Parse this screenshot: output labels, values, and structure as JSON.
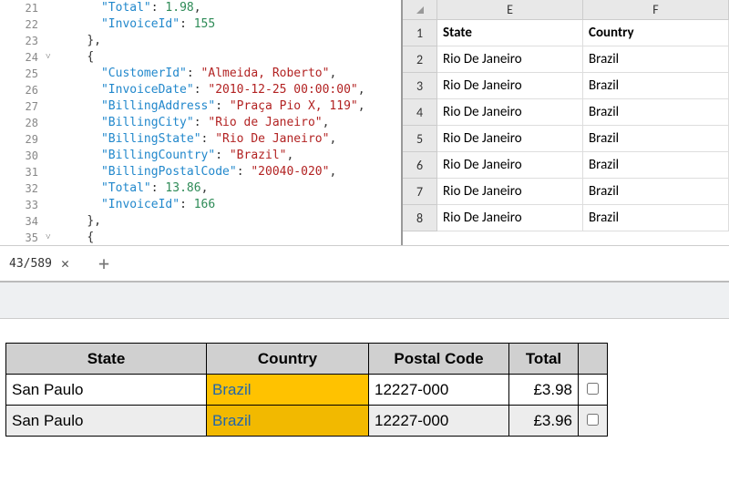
{
  "code": {
    "lines": [
      {
        "ln": 21,
        "fold": "",
        "indent": 6,
        "tokens": [
          {
            "t": "k",
            "v": "\"Total\""
          },
          {
            "t": "p",
            "v": ": "
          },
          {
            "t": "n",
            "v": "1.98"
          },
          {
            "t": "p",
            "v": ","
          }
        ]
      },
      {
        "ln": 22,
        "fold": "",
        "indent": 6,
        "tokens": [
          {
            "t": "k",
            "v": "\"InvoiceId\""
          },
          {
            "t": "p",
            "v": ": "
          },
          {
            "t": "n",
            "v": "155"
          }
        ]
      },
      {
        "ln": 23,
        "fold": "",
        "indent": 4,
        "tokens": [
          {
            "t": "p",
            "v": "},"
          }
        ]
      },
      {
        "ln": 24,
        "fold": "˅",
        "indent": 4,
        "tokens": [
          {
            "t": "p",
            "v": "{"
          }
        ]
      },
      {
        "ln": 25,
        "fold": "",
        "indent": 6,
        "tokens": [
          {
            "t": "k",
            "v": "\"CustomerId\""
          },
          {
            "t": "p",
            "v": ": "
          },
          {
            "t": "s",
            "v": "\"Almeida, Roberto\""
          },
          {
            "t": "p",
            "v": ","
          }
        ]
      },
      {
        "ln": 26,
        "fold": "",
        "indent": 6,
        "tokens": [
          {
            "t": "k",
            "v": "\"InvoiceDate\""
          },
          {
            "t": "p",
            "v": ": "
          },
          {
            "t": "s",
            "v": "\"2010-12-25 00:00:00\""
          },
          {
            "t": "p",
            "v": ","
          }
        ]
      },
      {
        "ln": 27,
        "fold": "",
        "indent": 6,
        "tokens": [
          {
            "t": "k",
            "v": "\"BillingAddress\""
          },
          {
            "t": "p",
            "v": ": "
          },
          {
            "t": "s",
            "v": "\"Praça Pio X, 119\""
          },
          {
            "t": "p",
            "v": ","
          }
        ]
      },
      {
        "ln": 28,
        "fold": "",
        "indent": 6,
        "tokens": [
          {
            "t": "k",
            "v": "\"BillingCity\""
          },
          {
            "t": "p",
            "v": ": "
          },
          {
            "t": "s",
            "v": "\"Rio de Janeiro\""
          },
          {
            "t": "p",
            "v": ","
          }
        ]
      },
      {
        "ln": 29,
        "fold": "",
        "indent": 6,
        "tokens": [
          {
            "t": "k",
            "v": "\"BillingState\""
          },
          {
            "t": "p",
            "v": ": "
          },
          {
            "t": "s",
            "v": "\"Rio De Janeiro\""
          },
          {
            "t": "p",
            "v": ","
          }
        ]
      },
      {
        "ln": 30,
        "fold": "",
        "indent": 6,
        "tokens": [
          {
            "t": "k",
            "v": "\"BillingCountry\""
          },
          {
            "t": "p",
            "v": ": "
          },
          {
            "t": "s",
            "v": "\"Brazil\""
          },
          {
            "t": "p",
            "v": ","
          }
        ]
      },
      {
        "ln": 31,
        "fold": "",
        "indent": 6,
        "tokens": [
          {
            "t": "k",
            "v": "\"BillingPostalCode\""
          },
          {
            "t": "p",
            "v": ": "
          },
          {
            "t": "s",
            "v": "\"20040-020\""
          },
          {
            "t": "p",
            "v": ","
          }
        ]
      },
      {
        "ln": 32,
        "fold": "",
        "indent": 6,
        "tokens": [
          {
            "t": "k",
            "v": "\"Total\""
          },
          {
            "t": "p",
            "v": ": "
          },
          {
            "t": "n",
            "v": "13.86"
          },
          {
            "t": "p",
            "v": ","
          }
        ]
      },
      {
        "ln": 33,
        "fold": "",
        "indent": 6,
        "tokens": [
          {
            "t": "k",
            "v": "\"InvoiceId\""
          },
          {
            "t": "p",
            "v": ": "
          },
          {
            "t": "n",
            "v": "166"
          }
        ]
      },
      {
        "ln": 34,
        "fold": "",
        "indent": 4,
        "tokens": [
          {
            "t": "p",
            "v": "},"
          }
        ]
      },
      {
        "ln": 35,
        "fold": "˅",
        "indent": 4,
        "tokens": [
          {
            "t": "p",
            "v": "{"
          }
        ]
      }
    ]
  },
  "sheet": {
    "cols": [
      "E",
      "F"
    ],
    "rows": [
      {
        "n": 1,
        "cells": [
          "State",
          "Country"
        ],
        "header": true
      },
      {
        "n": 2,
        "cells": [
          "Rio De Janeiro",
          "Brazil"
        ]
      },
      {
        "n": 3,
        "cells": [
          "Rio De Janeiro",
          "Brazil"
        ]
      },
      {
        "n": 4,
        "cells": [
          "Rio De Janeiro",
          "Brazil"
        ]
      },
      {
        "n": 5,
        "cells": [
          "Rio De Janeiro",
          "Brazil"
        ]
      },
      {
        "n": 6,
        "cells": [
          "Rio De Janeiro",
          "Brazil"
        ]
      },
      {
        "n": 7,
        "cells": [
          "Rio De Janeiro",
          "Brazil"
        ]
      },
      {
        "n": 8,
        "cells": [
          "Rio De Janeiro",
          "Brazil"
        ]
      }
    ]
  },
  "tab": {
    "label": "43/589",
    "close": "✕",
    "add": "+"
  },
  "grid": {
    "headers": [
      "State",
      "Country",
      "Postal Code",
      "Total",
      ""
    ],
    "rows": [
      {
        "state": "San Paulo",
        "country": "Brazil",
        "postal": "12227-000",
        "total": "£3.98"
      },
      {
        "state": "San Paulo",
        "country": "Brazil",
        "postal": "12227-000",
        "total": "£3.96"
      }
    ]
  }
}
